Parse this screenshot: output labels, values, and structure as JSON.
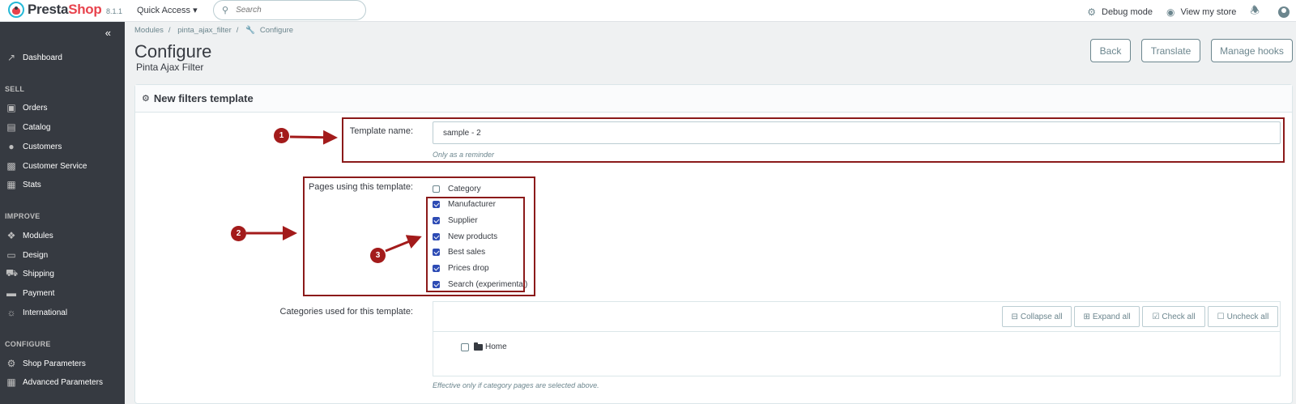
{
  "topbar": {
    "brand_presta": "Presta",
    "brand_shop": "Shop",
    "version": "8.1.1",
    "quick_access": "Quick Access ▾",
    "search_placeholder": "Search",
    "debug_mode": "Debug mode",
    "view_store": "View my store"
  },
  "sidebar": {
    "dashboard": "Dashboard",
    "sell_title": "SELL",
    "orders": "Orders",
    "catalog": "Catalog",
    "customers": "Customers",
    "customer_service": "Customer Service",
    "stats": "Stats",
    "improve_title": "IMPROVE",
    "modules": "Modules",
    "design": "Design",
    "shipping": "Shipping",
    "payment": "Payment",
    "international": "International",
    "configure_title": "CONFIGURE",
    "shop_parameters": "Shop Parameters",
    "advanced_parameters": "Advanced Parameters"
  },
  "header": {
    "breadcrumb": [
      "Modules",
      "pinta_ajax_filter",
      "Configure"
    ],
    "title": "Configure",
    "subtitle": "Pinta Ajax Filter",
    "back": "Back",
    "translate": "Translate",
    "manage_hooks": "Manage hooks"
  },
  "panel": {
    "title": "New filters template",
    "template_name_label": "Template name:",
    "template_name_value": "sample - 2",
    "template_name_help": "Only as a reminder",
    "pages_label": "Pages using this template:",
    "pages": [
      {
        "label": "Category",
        "checked": false
      },
      {
        "label": "Manufacturer",
        "checked": true
      },
      {
        "label": "Supplier",
        "checked": true
      },
      {
        "label": "New products",
        "checked": true
      },
      {
        "label": "Best sales",
        "checked": true
      },
      {
        "label": "Prices drop",
        "checked": true
      },
      {
        "label": "Search (experimental)",
        "checked": true
      }
    ],
    "categories_label": "Categories used for this template:",
    "collapse_all": "Collapse all",
    "expand_all": "Expand all",
    "check_all": "Check all",
    "uncheck_all": "Uncheck all",
    "tree_home": "Home",
    "categories_help": "Effective only if category pages are selected above."
  },
  "annotations": {
    "markers": [
      "1",
      "2",
      "3"
    ],
    "color": "#a31b1b"
  }
}
